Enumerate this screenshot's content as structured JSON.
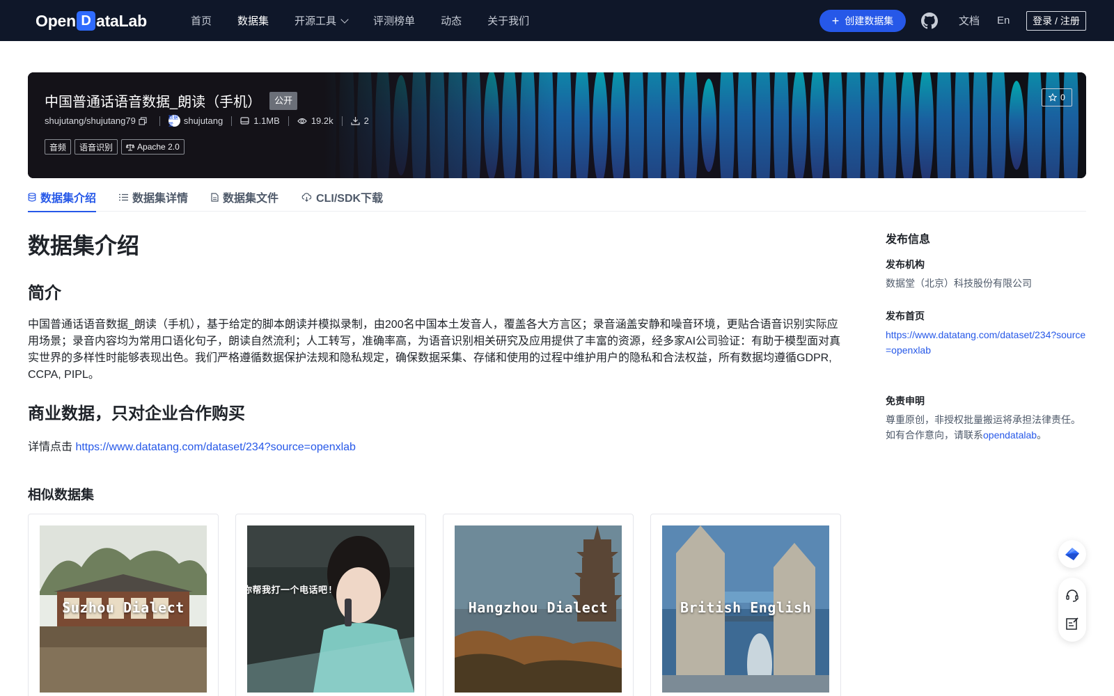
{
  "topbar": {
    "logo_left": "Open",
    "logo_mark": "D",
    "logo_right": "ataLab",
    "nav": [
      {
        "label": "首页",
        "active": false
      },
      {
        "label": "数据集",
        "active": true
      },
      {
        "label": "开源工具",
        "active": false,
        "dropdown": true
      },
      {
        "label": "评测榜单",
        "active": false
      },
      {
        "label": "动态",
        "active": false
      },
      {
        "label": "关于我们",
        "active": false
      }
    ],
    "create_label": "创建数据集",
    "create_icon": "plus-icon",
    "github_icon": "github-icon",
    "docs_label": "文档",
    "lang_label": "En",
    "login_label": "登录 / 注册"
  },
  "banner": {
    "title": "中国普通话语音数据_朗读（手机）",
    "badge": "公开",
    "repo": "shujutang/shujutang79",
    "publisher": "shujutang",
    "avatar_text": "数据堂",
    "size": "1.1MB",
    "views": "19.2k",
    "downloads": "2",
    "tags": [
      "音频",
      "语音识别"
    ],
    "license": "Apache 2.0",
    "stars": "0"
  },
  "tabs": [
    {
      "label": "数据集介绍",
      "icon": "database-icon",
      "active": true
    },
    {
      "label": "数据集详情",
      "icon": "list-icon",
      "active": false
    },
    {
      "label": "数据集文件",
      "icon": "file-icon",
      "active": false
    },
    {
      "label": "CLI/SDK下载",
      "icon": "cloud-download-icon",
      "active": false
    }
  ],
  "content": {
    "h1": "数据集介绍",
    "intro_heading": "简介",
    "intro_text": "中国普通话语音数据_朗读（手机），基于给定的脚本朗读并模拟录制，由200名中国本土发音人，覆盖各大方言区；录音涵盖安静和噪音环境，更贴合语音识别实际应用场景；录音内容均为常用口语化句子，朗读自然流利；人工转写，准确率高，为语音识别相关研究及应用提供了丰富的资源，经多家AI公司验证：有助于模型面对真实世界的多样性时能够表现出色。我们严格遵循数据保护法规和隐私规定，确保数据采集、存储和使用的过程中维护用户的隐私和合法权益，所有数据均遵循GDPR, CCPA, PIPL。",
    "commercial_heading": "商业数据，只对企业合作购买",
    "detail_prefix": "详情点击 ",
    "detail_link": "https://www.datatang.com/dataset/234?source=openxlab",
    "similar_heading": "相似数据集",
    "similar": [
      {
        "caption": "Suzhou Dialect"
      },
      {
        "caption": "你帮我打一个电话吧!"
      },
      {
        "caption": "Hangzhou Dialect"
      },
      {
        "caption": "British English"
      }
    ]
  },
  "sidebar": {
    "title": "发布信息",
    "org_label": "发布机构",
    "org_value": "数据堂（北京）科技股份有限公司",
    "home_label": "发布首页",
    "home_link": "https://www.datatang.com/dataset/234?source=openxlab",
    "disclaimer_label": "免责申明",
    "disclaimer_line1": "尊重原创，非授权批量搬运将承担法律责任。",
    "disclaimer_line2_prefix": "如有合作意向，请联系",
    "disclaimer_link": "opendatalab",
    "disclaimer_suffix": "。"
  },
  "floating": [
    "feishu-icon",
    "headset-icon",
    "feedback-icon"
  ],
  "colors": {
    "accent": "#2658e8",
    "topbar": "#0f1729",
    "banner": "#141218"
  }
}
